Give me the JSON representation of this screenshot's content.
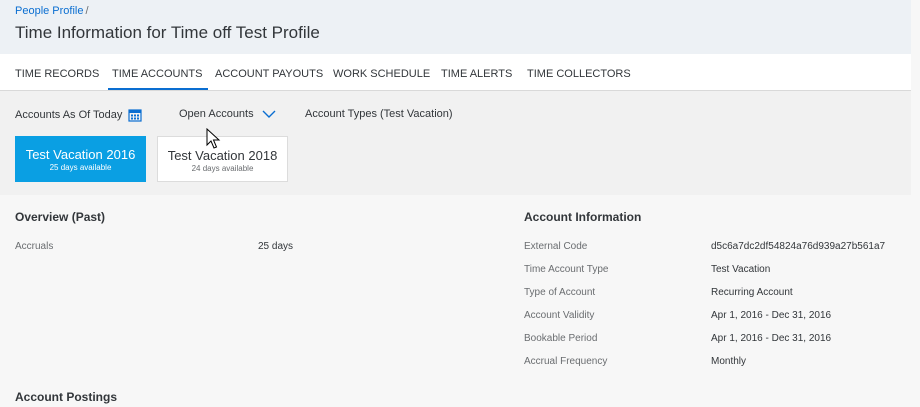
{
  "header": {
    "breadcrumb": "People Profile",
    "breadcrumb_sep": "/",
    "title": "Time Information for Time off Test Profile"
  },
  "tabs": [
    {
      "label": "TIME RECORDS"
    },
    {
      "label": "TIME ACCOUNTS",
      "active": true
    },
    {
      "label": "ACCOUNT PAYOUTS"
    },
    {
      "label": "WORK SCHEDULE"
    },
    {
      "label": "TIME ALERTS"
    },
    {
      "label": "TIME COLLECTORS"
    }
  ],
  "filters": {
    "as_of": "Accounts As Of Today",
    "open_accounts": "Open Accounts",
    "account_types": "Account Types (Test Vacation)"
  },
  "tiles": [
    {
      "title": "Test Vacation 2016",
      "subtitle": "25 days available",
      "selected": true
    },
    {
      "title": "Test Vacation 2018",
      "subtitle": "24 days available",
      "selected": false
    }
  ],
  "overview": {
    "title": "Overview (Past)",
    "rows": [
      {
        "label": "Accruals",
        "value": "25 days"
      }
    ]
  },
  "account_info": {
    "title": "Account Information",
    "rows": [
      {
        "label": "External Code",
        "value": "d5c6a7dc2df54824a76d939a27b561a7"
      },
      {
        "label": "Time Account Type",
        "value": "Test Vacation"
      },
      {
        "label": "Type of Account",
        "value": "Recurring Account"
      },
      {
        "label": "Account Validity",
        "value": "Apr 1, 2016 - Dec 31, 2016"
      },
      {
        "label": "Bookable Period",
        "value": "Apr 1, 2016 - Dec 31, 2016"
      },
      {
        "label": "Accrual Frequency",
        "value": "Monthly"
      }
    ]
  },
  "postings": {
    "title": "Account Postings"
  },
  "colors": {
    "accent": "#0a6ed1",
    "tile_selected": "#0a9fe3",
    "header_bg": "#edf1f5"
  },
  "icons": {
    "calendar": "calendar-icon",
    "chevron": "chevron-down-icon",
    "cursor": "mouse-cursor-icon"
  }
}
